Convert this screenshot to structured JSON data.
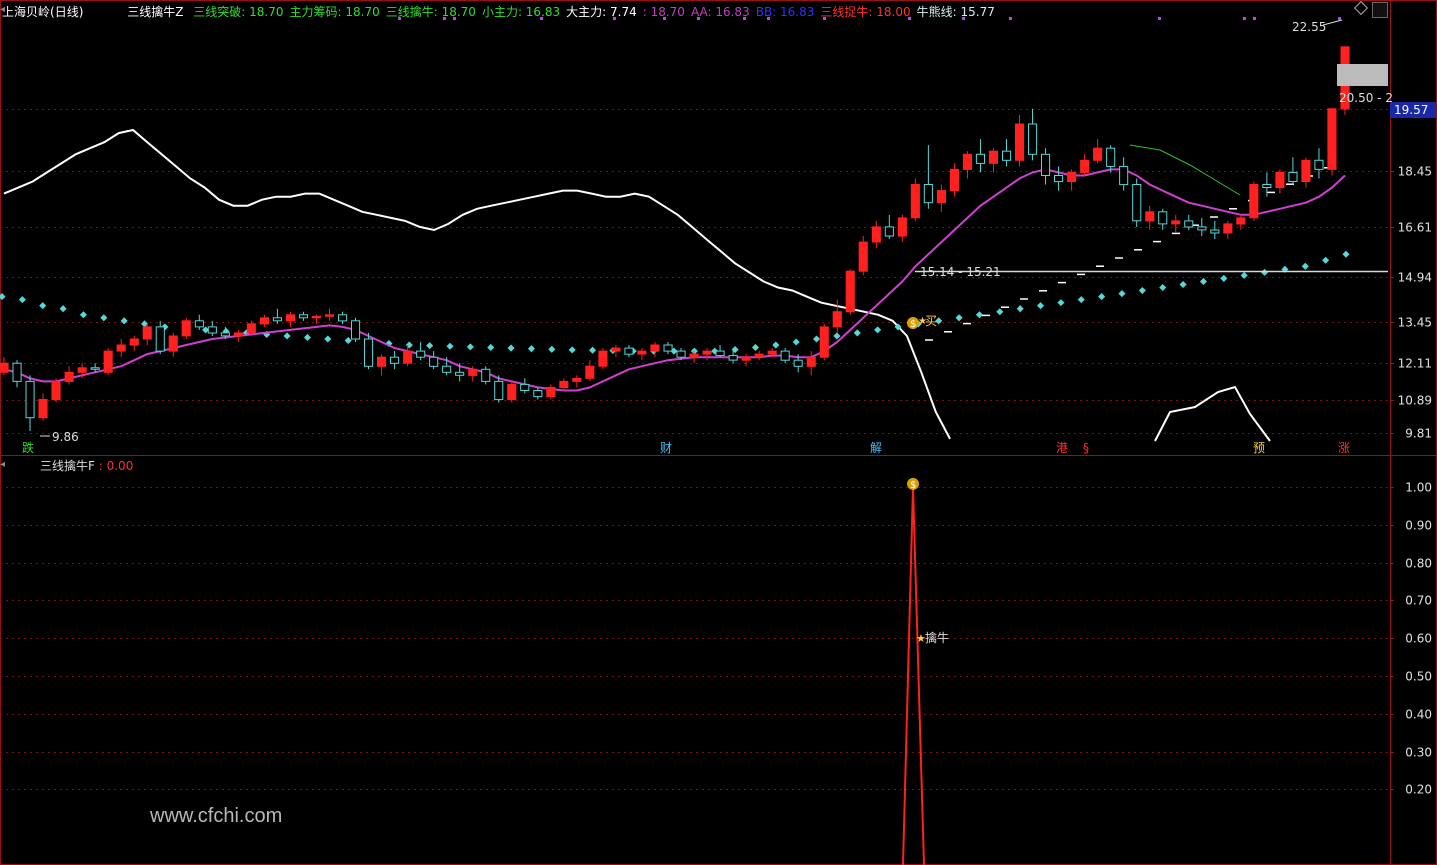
{
  "header": {
    "title": "上海贝岭",
    "period": "(日线)",
    "indicator_name": "三线擒牛Z",
    "items": [
      {
        "label": "三线突破",
        "value": "18.70",
        "color": "#33dd33"
      },
      {
        "label": "主力筹码",
        "value": "18.70",
        "color": "#33dd33"
      },
      {
        "label": "三线擒牛",
        "value": "18.70",
        "color": "#33dd33"
      },
      {
        "label": "小主力",
        "value": "16.83",
        "color": "#33dd33"
      },
      {
        "label": "大主力",
        "value": "7.74",
        "color": "#ffffff"
      },
      {
        "label": "",
        "value": "18.70",
        "color": "#c040c0"
      },
      {
        "label": "AA",
        "value": "16.83",
        "color": "#c040c0"
      },
      {
        "label": "BB",
        "value": "16.83",
        "color": "#3030ff"
      },
      {
        "label": "三线捉牛",
        "value": "18.00",
        "color": "#ff3030"
      },
      {
        "label": "牛熊线",
        "value": "15.77",
        "color": "#d0f0f0"
      }
    ]
  },
  "sub_header": {
    "name": "三线擒牛F",
    "value": "0.00"
  },
  "watermark": "www.cfchi.com",
  "annotations": {
    "high_label": "22.55",
    "low_label": "9.86",
    "range_label": "15.14 - 15.21",
    "box_label": "20.50 - 2",
    "buy_label": "买",
    "sub_peak_label": "擒牛",
    "price_box_value": "19.57"
  },
  "markers": [
    {
      "text": "跌",
      "color": "#33dd33"
    },
    {
      "text": "财",
      "color": "#40c0ff"
    },
    {
      "text": "解",
      "color": "#40c0ff"
    },
    {
      "text": "港",
      "color": "#ff3030"
    },
    {
      "text": "§",
      "color": "#ff3030"
    },
    {
      "text": "预",
      "color": "#ffd040"
    },
    {
      "text": "涨",
      "color": "#ff3030"
    }
  ],
  "colors": {
    "grid": "#7a1010",
    "up": "#ff2020",
    "down": "#54d8d8",
    "ma": "#d040d0",
    "white_line": "#ffffff",
    "dots": "#54d8d8",
    "axis_text": "#e0e0e0"
  },
  "chart_data": [
    {
      "type": "candlestick",
      "title": "上海贝岭 (日线)",
      "ylim": [
        9.3,
        23.5
      ],
      "y_ticks": [
        20.5,
        18.45,
        16.61,
        14.94,
        13.45,
        12.11,
        10.89,
        9.81
      ],
      "candles": [
        [
          11.8,
          12.3,
          11.7,
          12.1
        ],
        [
          12.1,
          12.2,
          11.3,
          11.5
        ],
        [
          11.5,
          11.7,
          9.86,
          10.3
        ],
        [
          10.3,
          11.1,
          10.2,
          10.9
        ],
        [
          10.9,
          11.6,
          10.8,
          11.5
        ],
        [
          11.5,
          12.0,
          11.4,
          11.8
        ],
        [
          11.8,
          12.1,
          11.6,
          11.95
        ],
        [
          11.95,
          12.1,
          11.8,
          11.9
        ],
        [
          11.8,
          12.6,
          11.7,
          12.5
        ],
        [
          12.5,
          12.9,
          12.3,
          12.7
        ],
        [
          12.7,
          13.0,
          12.5,
          12.9
        ],
        [
          12.9,
          13.4,
          12.7,
          13.3
        ],
        [
          13.3,
          13.5,
          12.4,
          12.5
        ],
        [
          12.5,
          13.1,
          12.3,
          13.0
        ],
        [
          13.0,
          13.6,
          12.9,
          13.5
        ],
        [
          13.5,
          13.7,
          13.2,
          13.3
        ],
        [
          13.3,
          13.5,
          13.0,
          13.1
        ],
        [
          13.1,
          13.3,
          12.9,
          13.0
        ],
        [
          13.0,
          13.2,
          12.8,
          13.1
        ],
        [
          13.1,
          13.5,
          13.0,
          13.4
        ],
        [
          13.4,
          13.7,
          13.3,
          13.6
        ],
        [
          13.6,
          13.9,
          13.4,
          13.5
        ],
        [
          13.5,
          13.8,
          13.3,
          13.7
        ],
        [
          13.7,
          13.8,
          13.5,
          13.6
        ],
        [
          13.6,
          13.7,
          13.4,
          13.65
        ],
        [
          13.65,
          13.9,
          13.5,
          13.7
        ],
        [
          13.7,
          13.8,
          13.4,
          13.5
        ],
        [
          13.5,
          13.6,
          12.8,
          12.9
        ],
        [
          12.9,
          13.1,
          11.9,
          12.0
        ],
        [
          12.0,
          12.4,
          11.7,
          12.3
        ],
        [
          12.3,
          12.5,
          11.9,
          12.1
        ],
        [
          12.1,
          12.7,
          12.0,
          12.5
        ],
        [
          12.5,
          12.8,
          12.2,
          12.3
        ],
        [
          12.3,
          12.5,
          11.9,
          12.0
        ],
        [
          12.0,
          12.3,
          11.7,
          11.8
        ],
        [
          11.8,
          12.1,
          11.5,
          11.7
        ],
        [
          11.7,
          12.0,
          11.5,
          11.9
        ],
        [
          11.9,
          12.0,
          11.4,
          11.5
        ],
        [
          11.5,
          11.7,
          10.8,
          10.9
        ],
        [
          10.9,
          11.5,
          10.8,
          11.4
        ],
        [
          11.4,
          11.6,
          11.1,
          11.2
        ],
        [
          11.2,
          11.3,
          10.9,
          11.0
        ],
        [
          11.0,
          11.4,
          10.9,
          11.3
        ],
        [
          11.3,
          11.6,
          11.2,
          11.5
        ],
        [
          11.5,
          11.7,
          11.3,
          11.6
        ],
        [
          11.6,
          12.2,
          11.5,
          12.0
        ],
        [
          12.0,
          12.6,
          11.9,
          12.5
        ],
        [
          12.5,
          12.7,
          12.3,
          12.6
        ],
        [
          12.6,
          12.7,
          12.3,
          12.4
        ],
        [
          12.4,
          12.6,
          12.2,
          12.5
        ],
        [
          12.5,
          12.8,
          12.3,
          12.7
        ],
        [
          12.7,
          12.8,
          12.4,
          12.5
        ],
        [
          12.5,
          12.6,
          12.2,
          12.3
        ],
        [
          12.3,
          12.5,
          12.1,
          12.4
        ],
        [
          12.4,
          12.6,
          12.2,
          12.5
        ],
        [
          12.5,
          12.7,
          12.3,
          12.35
        ],
        [
          12.35,
          12.5,
          12.1,
          12.2
        ],
        [
          12.2,
          12.4,
          12.0,
          12.3
        ],
        [
          12.3,
          12.5,
          12.2,
          12.4
        ],
        [
          12.4,
          12.6,
          12.3,
          12.5
        ],
        [
          12.5,
          12.6,
          12.1,
          12.2
        ],
        [
          12.2,
          12.4,
          11.8,
          12.0
        ],
        [
          12.0,
          12.5,
          11.7,
          12.3
        ],
        [
          12.3,
          13.4,
          12.2,
          13.3
        ],
        [
          13.3,
          14.2,
          13.1,
          13.8
        ],
        [
          13.8,
          15.2,
          13.7,
          15.14
        ],
        [
          15.14,
          16.3,
          15.0,
          16.1
        ],
        [
          16.1,
          16.8,
          15.9,
          16.6
        ],
        [
          16.6,
          17.0,
          16.2,
          16.3
        ],
        [
          16.3,
          17.0,
          16.1,
          16.9
        ],
        [
          16.9,
          18.2,
          16.8,
          18.0
        ],
        [
          18.0,
          19.3,
          17.2,
          17.4
        ],
        [
          17.4,
          18.0,
          17.1,
          17.8
        ],
        [
          17.8,
          18.7,
          17.6,
          18.5
        ],
        [
          18.5,
          19.1,
          18.2,
          19.0
        ],
        [
          19.0,
          19.5,
          18.4,
          18.7
        ],
        [
          18.7,
          19.2,
          18.4,
          19.1
        ],
        [
          19.1,
          19.5,
          18.6,
          18.8
        ],
        [
          18.8,
          20.3,
          18.6,
          20.0
        ],
        [
          20.0,
          20.5,
          18.8,
          19.0
        ],
        [
          19.0,
          19.2,
          18.0,
          18.3
        ],
        [
          18.3,
          18.6,
          17.8,
          18.1
        ],
        [
          18.1,
          18.5,
          17.8,
          18.4
        ],
        [
          18.4,
          19.0,
          18.3,
          18.8
        ],
        [
          18.8,
          19.5,
          18.7,
          19.2
        ],
        [
          19.2,
          19.3,
          18.4,
          18.6
        ],
        [
          18.6,
          18.9,
          17.8,
          18.0
        ],
        [
          18.0,
          18.2,
          16.6,
          16.8
        ],
        [
          16.8,
          17.3,
          16.5,
          17.1
        ],
        [
          17.1,
          17.2,
          16.5,
          16.7
        ],
        [
          16.7,
          17.0,
          16.4,
          16.8
        ],
        [
          16.8,
          17.0,
          16.5,
          16.6
        ],
        [
          16.6,
          16.9,
          16.3,
          16.5
        ],
        [
          16.5,
          16.8,
          16.2,
          16.4
        ],
        [
          16.4,
          16.8,
          16.2,
          16.7
        ],
        [
          16.7,
          17.0,
          16.5,
          16.9
        ],
        [
          16.9,
          18.1,
          16.8,
          18.0
        ],
        [
          18.0,
          18.4,
          17.6,
          17.9
        ],
        [
          17.9,
          18.5,
          17.7,
          18.4
        ],
        [
          18.4,
          18.9,
          18.0,
          18.1
        ],
        [
          18.1,
          18.9,
          17.9,
          18.8
        ],
        [
          18.8,
          19.2,
          18.2,
          18.5
        ],
        [
          18.5,
          20.5,
          18.3,
          20.5
        ],
        [
          20.5,
          22.55,
          20.3,
          22.55
        ]
      ],
      "ma_line": [
        11.9,
        11.8,
        11.6,
        11.5,
        11.5,
        11.6,
        11.7,
        11.8,
        11.9,
        12.0,
        12.2,
        12.4,
        12.5,
        12.6,
        12.7,
        12.8,
        12.9,
        12.95,
        13.0,
        13.05,
        13.1,
        13.15,
        13.2,
        13.25,
        13.3,
        13.35,
        13.3,
        13.2,
        13.0,
        12.8,
        12.6,
        12.5,
        12.4,
        12.3,
        12.2,
        12.0,
        11.9,
        11.8,
        11.6,
        11.5,
        11.4,
        11.3,
        11.25,
        11.2,
        11.2,
        11.3,
        11.5,
        11.7,
        11.9,
        12.0,
        12.1,
        12.2,
        12.25,
        12.3,
        12.3,
        12.3,
        12.3,
        12.3,
        12.3,
        12.35,
        12.35,
        12.3,
        12.3,
        12.5,
        12.8,
        13.2,
        13.6,
        14.0,
        14.4,
        14.8,
        15.3,
        15.7,
        16.1,
        16.5,
        16.9,
        17.3,
        17.6,
        17.9,
        18.2,
        18.4,
        18.5,
        18.4,
        18.3,
        18.3,
        18.4,
        18.5,
        18.5,
        18.3,
        18.0,
        17.8,
        17.6,
        17.4,
        17.3,
        17.2,
        17.1,
        17.0,
        17.0,
        17.1,
        17.2,
        17.3,
        17.4,
        17.6,
        17.9,
        18.3
      ],
      "trend_line": [
        17.7,
        17.9,
        18.1,
        18.4,
        18.7,
        19.0,
        19.2,
        19.4,
        19.7,
        19.8,
        19.4,
        19.0,
        18.6,
        18.2,
        17.9,
        17.5,
        17.3,
        17.3,
        17.5,
        17.6,
        17.6,
        17.7,
        17.7,
        17.5,
        17.3,
        17.1,
        17.0,
        16.9,
        16.8,
        16.6,
        16.5,
        16.7,
        17.0,
        17.2,
        17.3,
        17.4,
        17.5,
        17.6,
        17.7,
        17.8,
        17.8,
        17.7,
        17.6,
        17.6,
        17.7,
        17.6,
        17.3,
        17.0,
        16.6,
        16.2,
        15.8,
        15.4,
        15.1,
        14.8,
        14.6,
        14.5,
        14.3,
        14.1,
        14.0,
        13.9,
        13.8,
        13.7,
        13.5,
        13.0,
        11.8,
        10.5,
        9.6
      ],
      "support_level": 15.14,
      "dots_series": [
        14.3,
        14.2,
        14.0,
        13.9,
        13.7,
        13.6,
        13.5,
        13.4,
        13.3,
        13.25,
        13.2,
        13.15,
        13.1,
        13.05,
        13.0,
        12.95,
        12.9,
        12.85,
        12.8,
        12.75,
        12.7,
        12.68,
        12.66,
        12.64,
        12.62,
        12.6,
        12.58,
        12.56,
        12.54,
        12.53,
        12.52,
        12.5,
        12.5,
        12.5,
        12.5,
        12.5,
        12.55,
        12.62,
        12.7,
        12.8,
        12.9,
        13.0,
        13.1,
        13.2,
        13.3,
        13.4,
        13.5,
        13.6,
        13.7,
        13.8,
        13.9,
        14.0,
        14.1,
        14.2,
        14.3,
        14.4,
        14.5,
        14.6,
        14.7,
        14.8,
        14.9,
        15.0,
        15.1,
        15.2,
        15.3,
        15.5,
        15.7
      ]
    },
    {
      "type": "line",
      "title": "三线擒牛F",
      "ylim": [
        0,
        1.05
      ],
      "y_ticks": [
        1.0,
        0.9,
        0.8,
        0.7,
        0.6,
        0.5,
        0.4,
        0.3,
        0.2
      ],
      "signal": {
        "peak": 1.0,
        "peak_index": 65,
        "label_value": 0.6
      }
    }
  ]
}
